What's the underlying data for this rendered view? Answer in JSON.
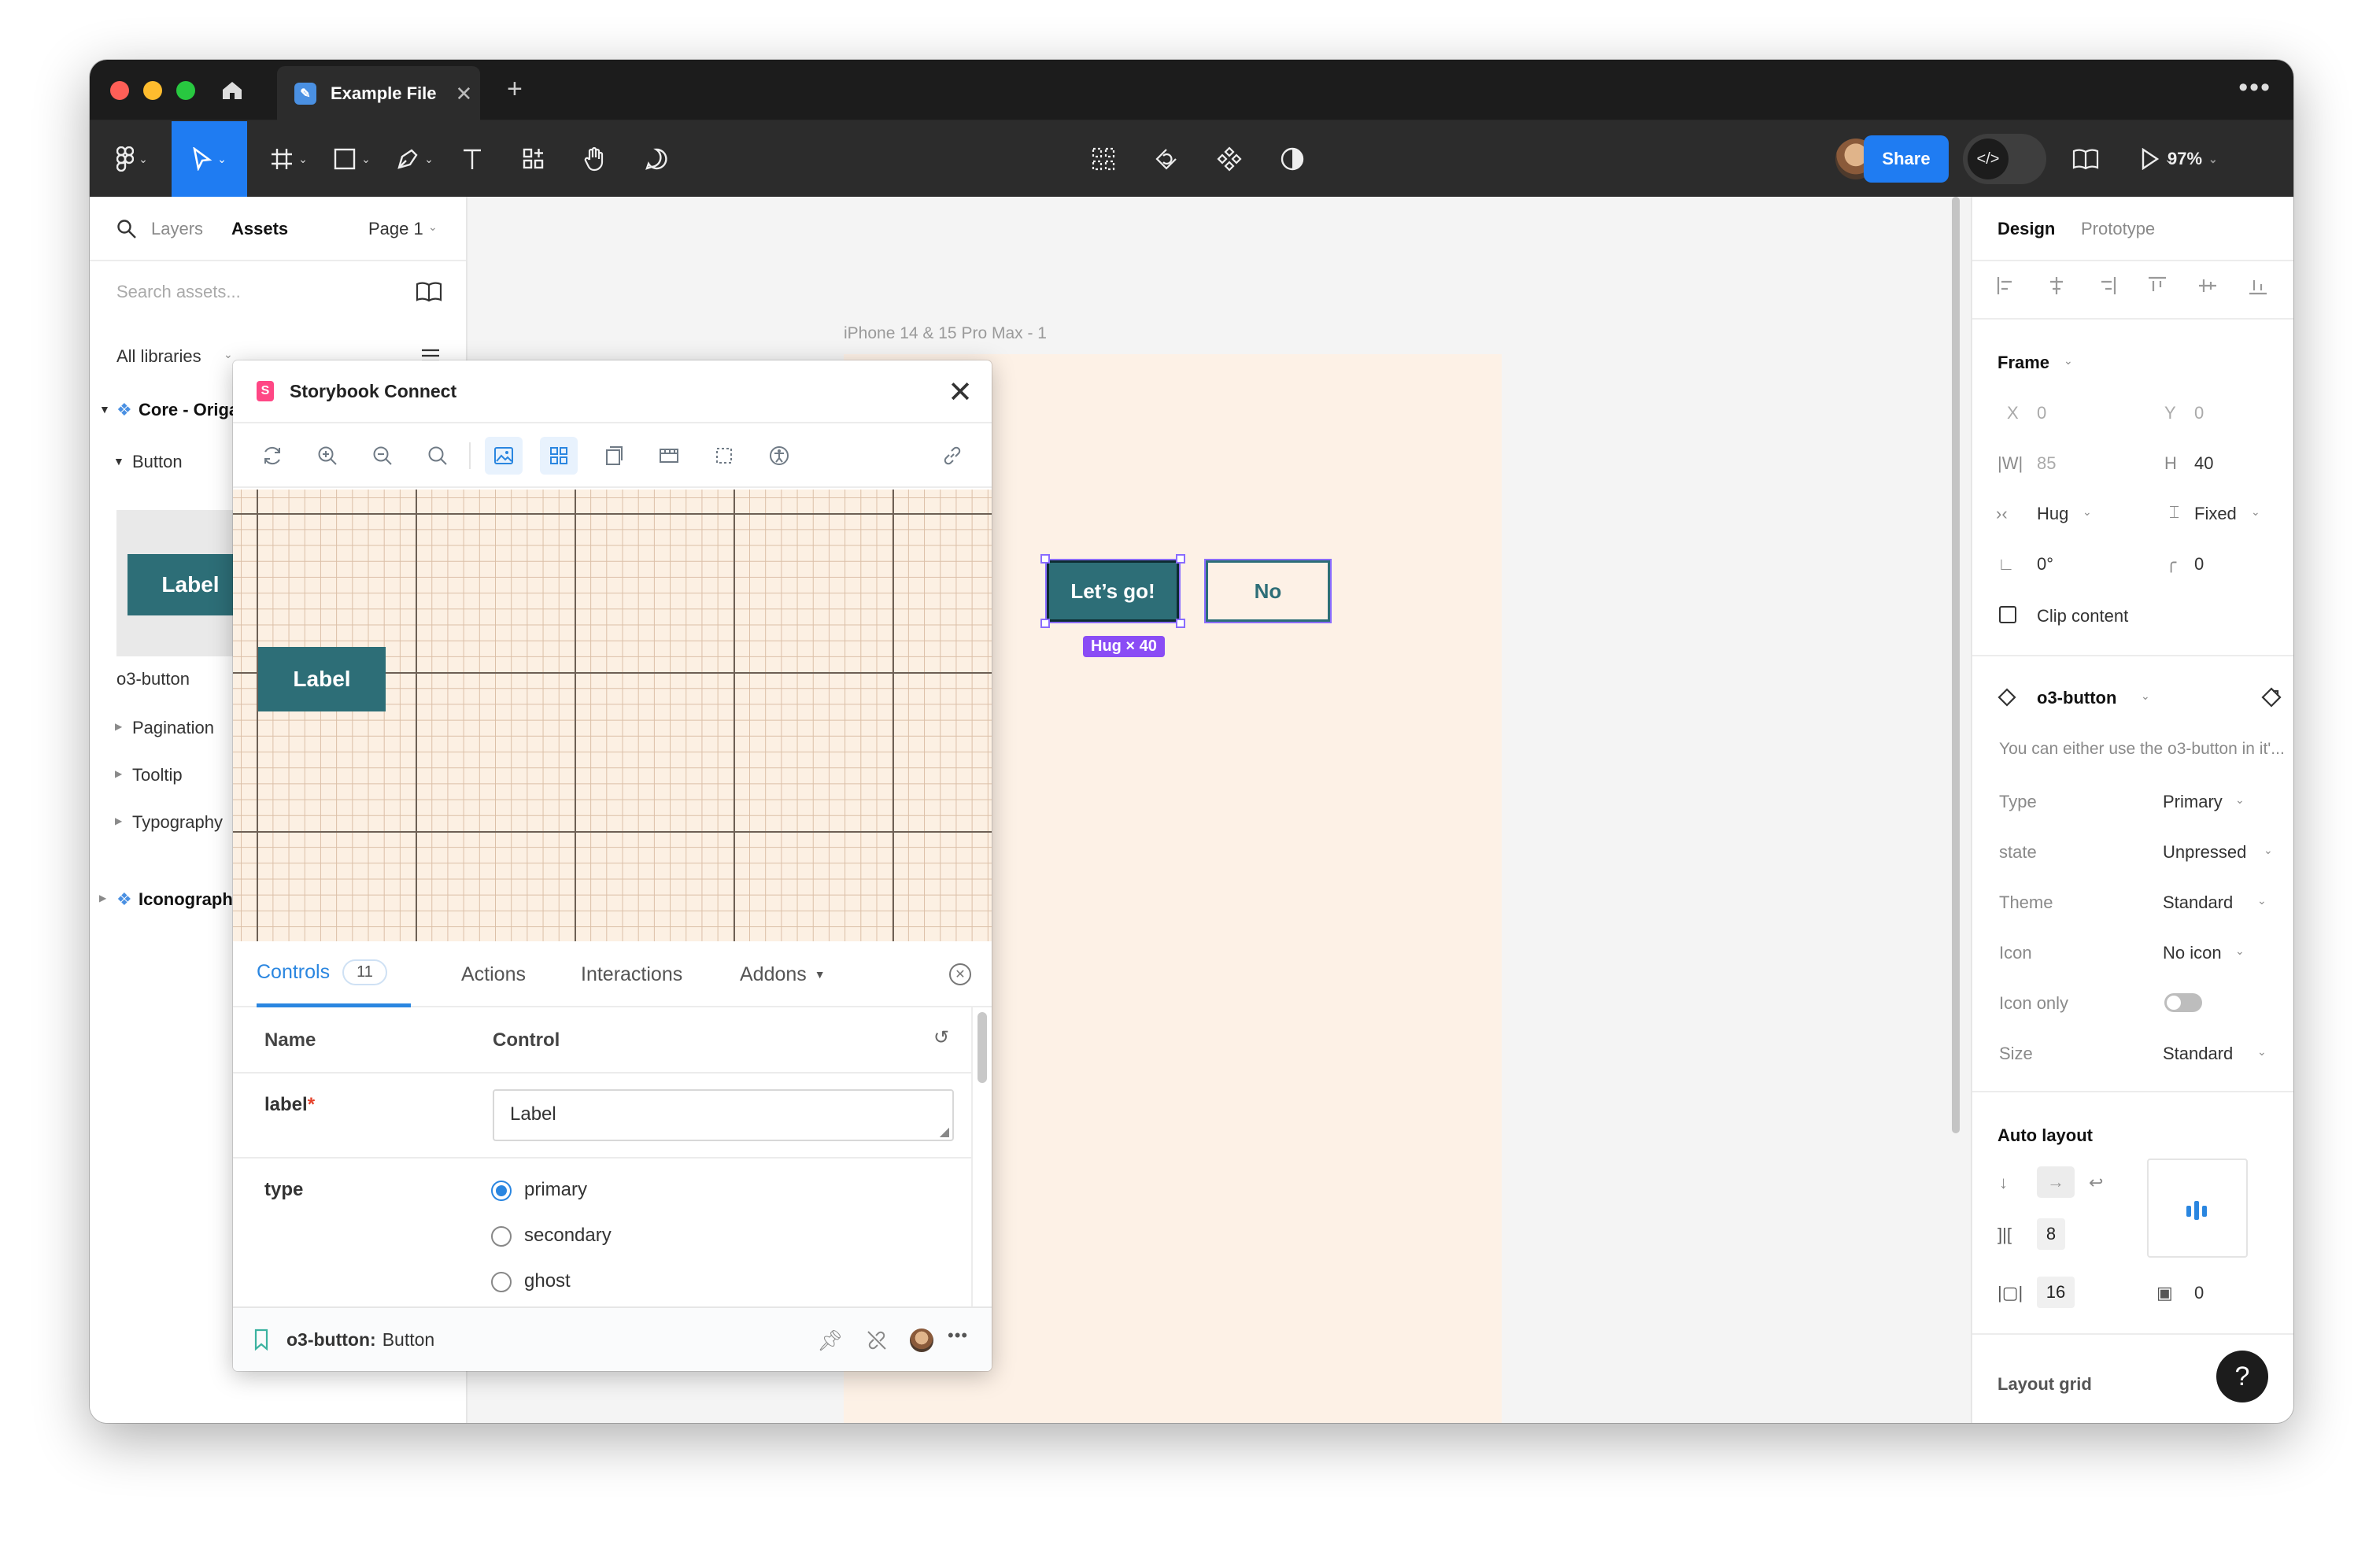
{
  "window": {
    "tab_title": "Example File"
  },
  "toolbar": {
    "share_label": "Share",
    "zoom_label": "97%"
  },
  "left_panel": {
    "tab_layers": "Layers",
    "tab_assets": "Assets",
    "page_selector": "Page 1",
    "search_placeholder": "Search assets...",
    "libraries_filter": "All libraries",
    "group_core": "Core - Origa",
    "button_section": "Button",
    "thumb_label": "Label",
    "component_name": "o3-button",
    "items": [
      "Pagination",
      "Tooltip",
      "Typography"
    ],
    "group_icon": "Iconograph"
  },
  "canvas": {
    "frame_label": "iPhone 14 & 15 Pro Max - 1",
    "primary_button": "Let’s go!",
    "secondary_button": "No",
    "size_badge": "Hug × 40"
  },
  "storybook": {
    "title": "Storybook Connect",
    "preview_label": "Label",
    "tabs": {
      "controls": "Controls",
      "controls_count": "11",
      "actions": "Actions",
      "interactions": "Interactions",
      "addons": "Addons"
    },
    "table": {
      "col_name": "Name",
      "col_control": "Control",
      "label_row_name": "label",
      "required_mark": "*",
      "label_value": "Label",
      "type_row_name": "type",
      "type_options": [
        "primary",
        "secondary",
        "ghost"
      ]
    },
    "footer": {
      "component": "o3-button:",
      "story": "Button"
    }
  },
  "design_panel": {
    "tab_design": "Design",
    "tab_prototype": "Prototype",
    "frame_section": "Frame",
    "x_label": "X",
    "x_value": "0",
    "y_label": "Y",
    "y_value": "0",
    "w_label": "|W|",
    "w_value": "85",
    "h_label": "H",
    "h_value": "40",
    "hug_label": "Hug",
    "fixed_label": "Fixed",
    "rotation": "0°",
    "radius": "0",
    "clip_content": "Clip content",
    "component_name": "o3-button",
    "description": "You can either use the o3-button in it'...",
    "properties": [
      {
        "label": "Type",
        "value": "Primary"
      },
      {
        "label": "state",
        "value": "Unpressed"
      },
      {
        "label": "Theme",
        "value": "Standard"
      },
      {
        "label": "Icon",
        "value": "No icon"
      },
      {
        "label": "Icon only",
        "value": ""
      },
      {
        "label": "Size",
        "value": "Standard"
      }
    ],
    "auto_layout_title": "Auto layout",
    "gap_value": "8",
    "padding_h": "16",
    "padding_v": "0",
    "layout_grid_title": "Layout grid"
  },
  "help_label": "?"
}
